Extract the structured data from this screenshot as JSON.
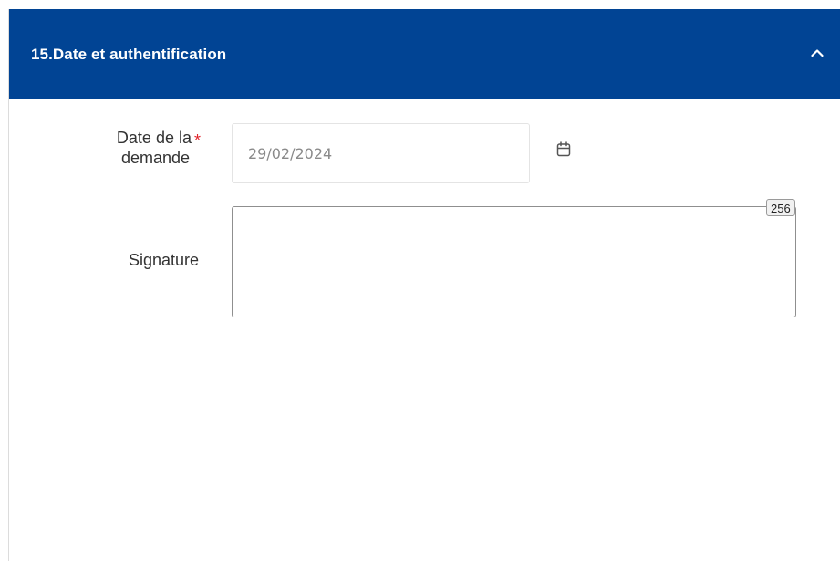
{
  "section": {
    "title": "15.Date et authentification",
    "collapse_icon": "chevron-up-icon",
    "header_color": "#014494"
  },
  "fields": {
    "date": {
      "label": "Date de la demande",
      "label_line1": "Date de la",
      "label_line2": "demande",
      "required_marker": "*",
      "value": "29/02/2024",
      "calendar_icon": "calendar-icon"
    },
    "signature": {
      "label": "Signature",
      "value": "",
      "remaining_chars": "256"
    }
  },
  "colors": {
    "required": "#e0242b"
  }
}
